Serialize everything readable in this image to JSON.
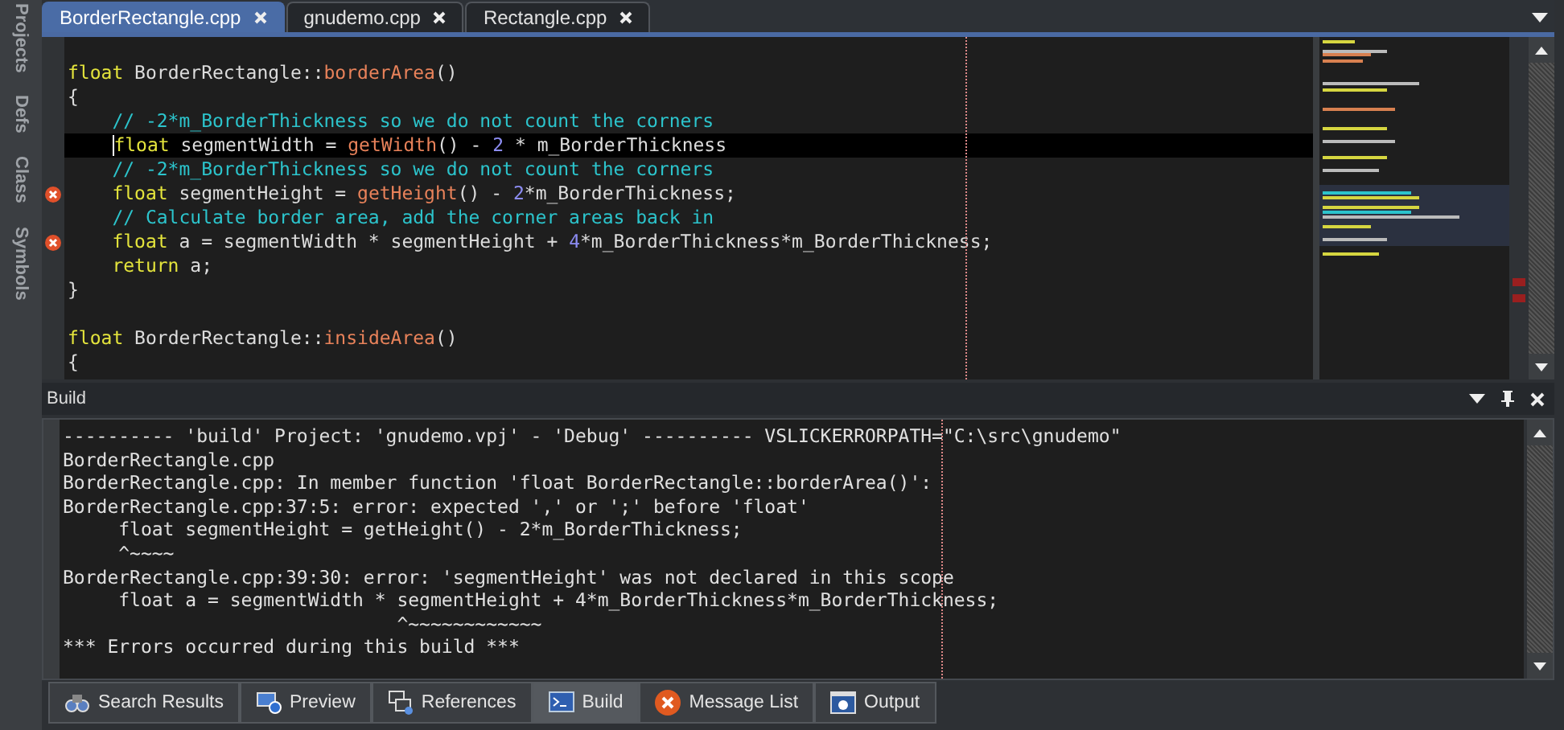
{
  "side_tabs": [
    {
      "label": "Projects"
    },
    {
      "label": "Defs"
    },
    {
      "label": "Class"
    },
    {
      "label": "Symbols"
    }
  ],
  "editor_tabs": [
    {
      "label": "BorderRectangle.cpp",
      "selected": true
    },
    {
      "label": "gnudemo.cpp",
      "selected": false
    },
    {
      "label": "Rectangle.cpp",
      "selected": false
    }
  ],
  "code_lines": [
    {
      "blank_before": true,
      "current": false,
      "error": false,
      "tokens": [
        {
          "kind": "keyword",
          "text": "float"
        },
        {
          "kind": "ident",
          "text": " BorderRectangle::"
        },
        {
          "kind": "func",
          "text": "borderArea"
        },
        {
          "kind": "ident",
          "text": "()"
        }
      ]
    },
    {
      "blank_before": false,
      "current": false,
      "error": false,
      "tokens": [
        {
          "kind": "ident",
          "text": "{"
        }
      ]
    },
    {
      "blank_before": false,
      "current": false,
      "error": false,
      "tokens": [
        {
          "kind": "comment",
          "text": "    // -2*m_BorderThickness so we do not count the corners"
        }
      ]
    },
    {
      "blank_before": false,
      "current": true,
      "error": false,
      "tokens": [
        {
          "kind": "keyword",
          "text": "    float"
        },
        {
          "kind": "ident",
          "text": " segmentWidth = "
        },
        {
          "kind": "func",
          "text": "getWidth"
        },
        {
          "kind": "ident",
          "text": "() - "
        },
        {
          "kind": "number",
          "text": "2"
        },
        {
          "kind": "ident",
          "text": " * m_BorderThickness"
        }
      ]
    },
    {
      "blank_before": false,
      "current": false,
      "error": false,
      "tokens": [
        {
          "kind": "comment",
          "text": "    // -2*m_BorderThickness so we do not count the corners"
        }
      ]
    },
    {
      "blank_before": false,
      "current": false,
      "error": true,
      "tokens": [
        {
          "kind": "keyword",
          "text": "    float"
        },
        {
          "kind": "ident",
          "text": " segmentHeight = "
        },
        {
          "kind": "func",
          "text": "getHeight"
        },
        {
          "kind": "ident",
          "text": "() - "
        },
        {
          "kind": "number",
          "text": "2"
        },
        {
          "kind": "ident",
          "text": "*m_BorderThickness;"
        }
      ]
    },
    {
      "blank_before": false,
      "current": false,
      "error": false,
      "tokens": [
        {
          "kind": "comment",
          "text": "    // Calculate border area, add the corner areas back in"
        }
      ]
    },
    {
      "blank_before": false,
      "current": false,
      "error": true,
      "tokens": [
        {
          "kind": "keyword",
          "text": "    float"
        },
        {
          "kind": "ident",
          "text": " a = segmentWidth * segmentHeight + "
        },
        {
          "kind": "number",
          "text": "4"
        },
        {
          "kind": "ident",
          "text": "*m_BorderThickness*m_BorderThickness;"
        }
      ]
    },
    {
      "blank_before": false,
      "current": false,
      "error": false,
      "tokens": [
        {
          "kind": "keyword",
          "text": "    return"
        },
        {
          "kind": "ident",
          "text": " a;"
        }
      ]
    },
    {
      "blank_before": false,
      "current": false,
      "error": false,
      "tokens": [
        {
          "kind": "ident",
          "text": "}"
        }
      ]
    },
    {
      "blank_before": true,
      "current": false,
      "error": false,
      "tokens": [
        {
          "kind": "keyword",
          "text": "float"
        },
        {
          "kind": "ident",
          "text": " BorderRectangle::"
        },
        {
          "kind": "func",
          "text": "insideArea"
        },
        {
          "kind": "ident",
          "text": "()"
        }
      ]
    },
    {
      "blank_before": false,
      "current": false,
      "error": false,
      "tokens": [
        {
          "kind": "ident",
          "text": "{"
        }
      ]
    }
  ],
  "build_panel": {
    "title": "Build",
    "lines": [
      "---------- 'build' Project: 'gnudemo.vpj' - 'Debug' ---------- VSLICKERRORPATH=\"C:\\src\\gnudemo\"",
      "BorderRectangle.cpp",
      "BorderRectangle.cpp: In member function 'float BorderRectangle::borderArea()':",
      "BorderRectangle.cpp:37:5: error: expected ',' or ';' before 'float'",
      "     float segmentHeight = getHeight() - 2*m_BorderThickness;",
      "     ^~~~~",
      "BorderRectangle.cpp:39:30: error: 'segmentHeight' was not declared in this scope",
      "     float a = segmentWidth * segmentHeight + 4*m_BorderThickness*m_BorderThickness;",
      "                              ^~~~~~~~~~~~~",
      "*** Errors occurred during this build ***"
    ]
  },
  "bottom_tabs": [
    {
      "kind": "search",
      "label": "Search Results",
      "selected": false
    },
    {
      "kind": "preview",
      "label": "Preview",
      "selected": false
    },
    {
      "kind": "references",
      "label": "References",
      "selected": false
    },
    {
      "kind": "build",
      "label": "Build",
      "selected": true
    },
    {
      "kind": "messages",
      "label": "Message List",
      "selected": false
    },
    {
      "kind": "output",
      "label": "Output",
      "selected": false
    }
  ]
}
